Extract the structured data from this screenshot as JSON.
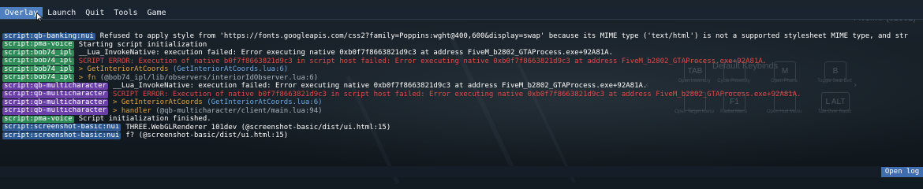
{
  "menu": {
    "items": [
      "Overlay",
      "Launch",
      "Quit",
      "Tools",
      "Game"
    ],
    "active": "Overlay"
  },
  "watermark": "FiveM® (b2802)",
  "keybinds": {
    "title": "Default Keybinds",
    "keys": [
      {
        "key": "TAB",
        "caption": "Open Inventory"
      },
      {
        "key": "",
        "caption": "Cycle Proximity"
      },
      {
        "key": "M",
        "caption": "Open Phone"
      },
      {
        "key": "B",
        "caption": "Toggle Seat Belt"
      },
      {
        "key": "",
        "caption": "Open Target Menu"
      },
      {
        "key": "F1",
        "caption": "Radial Menu"
      },
      {
        "key": "",
        "caption": "Open Hud Menu"
      },
      {
        "key": "L ALT",
        "caption": "Talk Over Radio"
      }
    ]
  },
  "colors": {
    "tag_blue": "#2d5a94",
    "tag_green": "#2e8b57",
    "tag_purple": "#6a3fa8",
    "msg_default": "#ffffff",
    "msg_error": "#e04848",
    "msg_warn": "#e0a13c",
    "msg_dim": "#aab3bc",
    "link": "#6fa7e0",
    "open_log": "#3f6db0"
  },
  "log": [
    {
      "tag": "script:qb-banking:nui",
      "tagColor": "#2d5a94",
      "segments": [
        {
          "text": "Refused to apply style from 'https://fonts.googleapis.com/css2?family=Poppins:wght@400,600&display=swap' because its MIME type ('text/html') is not a supported stylesheet MIME type, and str",
          "color": "#ffffff"
        }
      ]
    },
    {
      "tag": "script:pma-voice",
      "tagColor": "#2e8b57",
      "segments": [
        {
          "text": "Starting script initialization",
          "color": "#ffffff"
        }
      ]
    },
    {
      "tag": "script:bob74_ipl",
      "tagColor": "#2e8b57",
      "segments": [
        {
          "text": "__Lua_InvokeNative: execution failed: Error executing native 0xb0f7f8663821d9c3 at address FiveM_b2802_GTAProcess.exe+92A81A.",
          "color": "#ffffff"
        }
      ]
    },
    {
      "tag": "script:bob74_ipl",
      "tagColor": "#2e8b57",
      "segments": [
        {
          "text": "SCRIPT ERROR: Execution of native b0f7f8663821d9c3 in script host failed: Error executing native 0xb0f7f8663821d9c3 at address FiveM_b2802_GTAProcess.exe+92A81A.",
          "color": "#e04848"
        }
      ]
    },
    {
      "tag": "script:bob74_ipl",
      "tagColor": "#2e8b57",
      "segments": [
        {
          "text": "> GetInteriorAtCoords ",
          "color": "#e0a13c"
        },
        {
          "text": "(GetInteriorAtCoords.lua:6)",
          "color": "#6fa7e0"
        }
      ]
    },
    {
      "tag": "script:bob74_ipl",
      "tagColor": "#2e8b57",
      "segments": [
        {
          "text": "> fn ",
          "color": "#e0a13c"
        },
        {
          "text": "(@bob74_ipl/lib/observers/interiorIdObserver.lua:6)",
          "color": "#aab3bc"
        }
      ]
    },
    {
      "tag": "script:qb-multicharacter",
      "tagColor": "#6a3fa8",
      "segments": [
        {
          "text": "__Lua_InvokeNative: execution failed: Error executing native 0xb0f7f8663821d9c3 at address FiveM_b2802_GTAProcess.exe+92A81A.",
          "color": "#ffffff"
        }
      ]
    },
    {
      "tag": "script:qb-multicharacter",
      "tagColor": "#6a3fa8",
      "segments": [
        {
          "text": "SCRIPT ERROR: Execution of native b0f7f8663821d9c3 in script host failed: Error executing native 0xb0f7f8663821d9c3 at address FiveM_b2802_GTAProcess.exe+92A81A.",
          "color": "#e04848"
        }
      ]
    },
    {
      "tag": "script:qb-multicharacter",
      "tagColor": "#6a3fa8",
      "segments": [
        {
          "text": "> GetInteriorAtCoords ",
          "color": "#e0a13c"
        },
        {
          "text": "(GetInteriorAtCoords.lua:6)",
          "color": "#6fa7e0"
        }
      ]
    },
    {
      "tag": "script:qb-multicharacter",
      "tagColor": "#6a3fa8",
      "segments": [
        {
          "text": "> handler ",
          "color": "#e0a13c"
        },
        {
          "text": "(@qb-multicharacter/client/main.lua:94)",
          "color": "#aab3bc"
        }
      ]
    },
    {
      "tag": "script:pma-voice",
      "tagColor": "#2e8b57",
      "segments": [
        {
          "text": "Script initialization finished.",
          "color": "#ffffff"
        }
      ]
    },
    {
      "tag": "script:screenshot-basic:nui",
      "tagColor": "#2d5a94",
      "segments": [
        {
          "text": "THREE.WebGLRenderer 101dev (@screenshot-basic/dist/ui.html:15)",
          "color": "#ffffff"
        }
      ]
    },
    {
      "tag": "script:screenshot-basic:nui",
      "tagColor": "#2d5a94",
      "segments": [
        {
          "text": "f? (@screenshot-basic/dist/ui.html:15)",
          "color": "#ffffff"
        }
      ]
    }
  ],
  "input": {
    "value": "",
    "placeholder": ""
  },
  "open_log_label": "Open log"
}
